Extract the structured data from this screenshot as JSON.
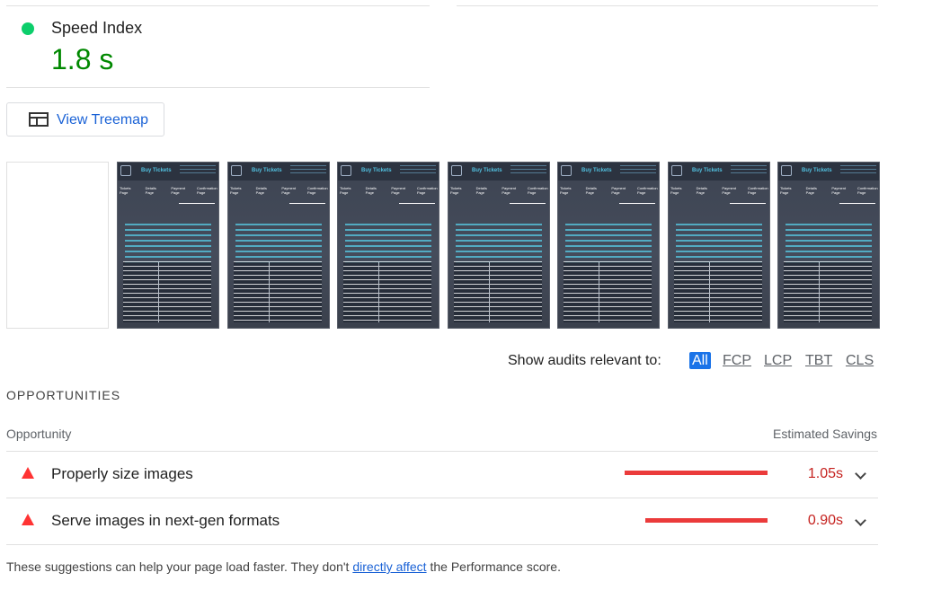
{
  "metric": {
    "label": "Speed Index",
    "value": "1.8 s",
    "status_color": "#0cce6b"
  },
  "treemap": {
    "label": "View Treemap",
    "icon": "treemap-icon"
  },
  "filmstrip": {
    "frames": [
      {
        "blank": true
      },
      {
        "title": "Buy Tickets",
        "steps": [
          "Tickets Page",
          "Details Page",
          "Payment Page",
          "Confirmation Page"
        ]
      },
      {
        "title": "Buy Tickets",
        "steps": [
          "Tickets Page",
          "Details Page",
          "Payment Page",
          "Confirmation Page"
        ]
      },
      {
        "title": "Buy Tickets",
        "steps": [
          "Tickets Page",
          "Details Page",
          "Payment Page",
          "Confirmation Page"
        ]
      },
      {
        "title": "Buy Tickets",
        "steps": [
          "Tickets Page",
          "Details Page",
          "Payment Page",
          "Confirmation Page"
        ]
      },
      {
        "title": "Buy Tickets",
        "steps": [
          "Tickets Page",
          "Details Page",
          "Payment Page",
          "Confirmation Page"
        ]
      },
      {
        "title": "Buy Tickets",
        "steps": [
          "Tickets Page",
          "Details Page",
          "Payment Page",
          "Confirmation Page"
        ]
      },
      {
        "title": "Buy Tickets",
        "steps": [
          "Tickets Page",
          "Details Page",
          "Payment Page",
          "Confirmation Page"
        ]
      }
    ]
  },
  "filters": {
    "label": "Show audits relevant to:",
    "options": [
      "All",
      "FCP",
      "LCP",
      "TBT",
      "CLS"
    ],
    "active": "All"
  },
  "opportunities": {
    "section_title": "OPPORTUNITIES",
    "col_left": "Opportunity",
    "col_right": "Estimated Savings",
    "rows": [
      {
        "label": "Properly size images",
        "value": "1.05s"
      },
      {
        "label": "Serve images in next-gen formats",
        "value": "0.90s"
      }
    ]
  },
  "footer": {
    "before": "These suggestions can help your page load faster. They don't ",
    "link": "directly affect",
    "after": " the Performance score."
  },
  "colors": {
    "fail": "#ff3333",
    "bar": "#eb3b3b",
    "link": "#1a62d6"
  }
}
